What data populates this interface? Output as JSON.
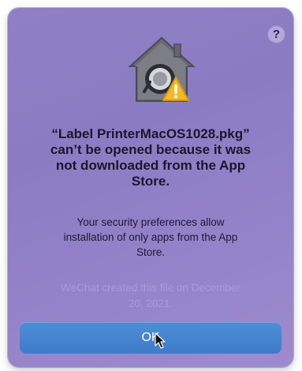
{
  "dialog": {
    "help_label": "?",
    "headline_lines": [
      "“Label PrinterMacOS1028.pkg”",
      "can’t be opened because it was",
      "not downloaded from the App",
      "Store."
    ],
    "body_lines": [
      "Your security preferences allow",
      "installation of only apps from the App",
      "Store."
    ],
    "origin_lines": [
      "WeChat created this file on December",
      "20, 2021."
    ],
    "ok_label": "OK",
    "icons": {
      "main": "security-house-icon",
      "badge": "warning-triangle-icon",
      "pointer": "mouse-cursor-icon"
    },
    "colors": {
      "dialog_background": "#8f80c4",
      "button_blue": "#4a87d2",
      "warning_yellow": "#f2b92c",
      "origin_text": "#a999dc"
    }
  }
}
